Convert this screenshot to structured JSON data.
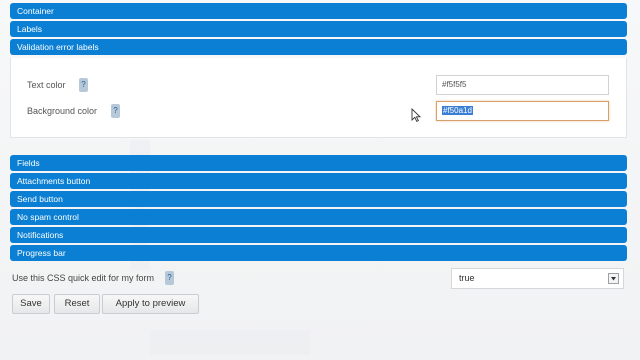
{
  "sections_top": [
    {
      "label": "Container"
    },
    {
      "label": "Labels"
    },
    {
      "label": "Validation error labels"
    }
  ],
  "validation_panel": {
    "text_color": {
      "label": "Text color",
      "value": "#f5f5f5"
    },
    "background_color": {
      "label": "Background color",
      "value": "#f50a1d"
    },
    "help_glyph": "?"
  },
  "sections_bottom": [
    {
      "label": "Fields"
    },
    {
      "label": "Attachments button"
    },
    {
      "label": "Send button"
    },
    {
      "label": "No spam control"
    },
    {
      "label": "Notifications"
    },
    {
      "label": "Progress bar"
    }
  ],
  "quick_edit": {
    "label": "Use this CSS quick edit for my form",
    "help_glyph": "?",
    "selected": "true"
  },
  "buttons": {
    "save": "Save",
    "reset": "Reset",
    "apply": "Apply to preview"
  },
  "colors": {
    "section_bar": "#0a7fd4",
    "help_badge": "#b7c9d9"
  }
}
